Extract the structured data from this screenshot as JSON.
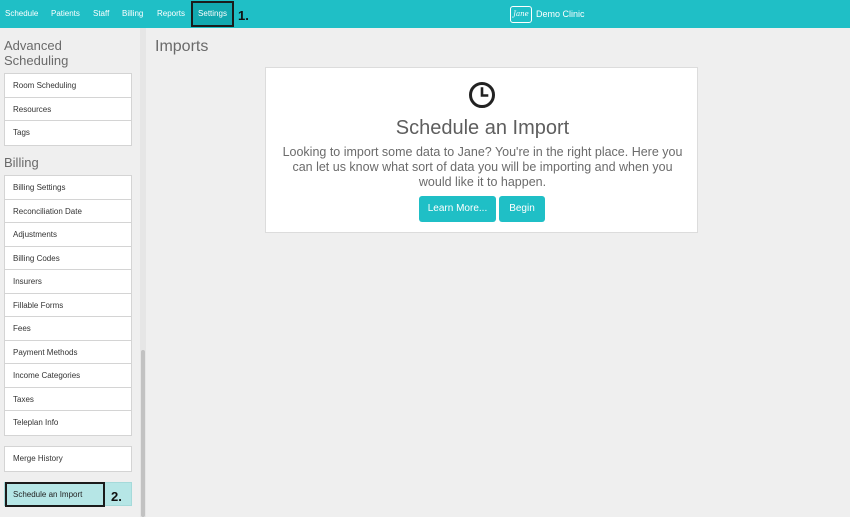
{
  "nav": {
    "items": [
      "Schedule",
      "Patients",
      "Staff",
      "Billing",
      "Reports"
    ],
    "settings": "Settings",
    "annotation": "1."
  },
  "brand": {
    "logo_text": "Jane",
    "name": "Demo Clinic"
  },
  "sidebar": {
    "advanced_heading": "Advanced Scheduling",
    "advanced_items": [
      "Room Scheduling",
      "Resources",
      "Tags"
    ],
    "billing_heading": "Billing",
    "billing_items": [
      "Billing Settings",
      "Reconciliation Date",
      "Adjustments",
      "Billing Codes",
      "Insurers",
      "Fillable Forms",
      "Fees",
      "Payment Methods",
      "Income Categories",
      "Taxes",
      "Teleplan Info"
    ],
    "merge_item": "Merge History",
    "active_item": "Schedule an Import",
    "annotation": "2."
  },
  "main": {
    "title": "Imports",
    "card": {
      "icon": "clock-icon",
      "title": "Schedule an Import",
      "description": "Looking to import some data to Jane? You're in the right place. Here you can let us know what sort of data you will be importing and when you would like it to happen.",
      "learn_more": "Learn More...",
      "begin": "Begin"
    }
  },
  "colors": {
    "accent": "#1fbfc6",
    "active_bg": "#b6e6e6"
  }
}
